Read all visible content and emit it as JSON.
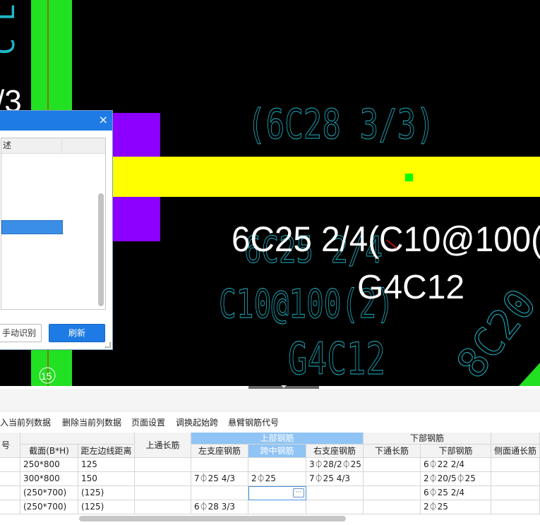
{
  "cad": {
    "frag_top_left": "C L",
    "frag_fraction": "/3",
    "annot_cyan_top": "(6C28 3/3)",
    "annot_white_main": "6C25 2/4(C10@100(",
    "annot_cyan_mid": "6C25 2/4",
    "annot_cyan_stirrup": "C10@100(2)",
    "annot_white_g": "G4C12",
    "annot_cyan_g": "G4C12",
    "annot_cyan_diag": "8C20",
    "axis_label": "15",
    "colors": {
      "background": "#000000",
      "column_green": "#22e022",
      "beam_yellow": "#ffff00",
      "support_purple": "#8b00ff",
      "cyan_text": "#1fb7c8",
      "white_text": "#ffffff",
      "axis_red": "#e01010"
    }
  },
  "dialog": {
    "close_icon": "×",
    "list_header": "述",
    "btn_manual": "手动识别",
    "btn_refresh": "刷新"
  },
  "toolbar": {
    "items": [
      "入当前列数据",
      "删除当前列数据",
      "页面设置",
      "调换起始跨",
      "悬臂钢筋代号"
    ]
  },
  "table": {
    "group_headers": {
      "top_rebar": "上部钢筋",
      "bottom_rebar": "下部钢筋"
    },
    "headers": {
      "id": "号",
      "section": "截面(B*H)",
      "dist_left": "距左边线距离",
      "top_through": "上通长筋",
      "left_support": "左支座钢筋",
      "mid_span": "跨中钢筋",
      "right_support": "右支座钢筋",
      "bottom_through": "下通长筋",
      "bottom_rebar": "下部钢筋",
      "side_through": "侧面通长筋"
    },
    "rows": [
      {
        "section": "250*800",
        "dist": "125",
        "top_through": "",
        "left_support": "",
        "mid_span": "",
        "right_support": "3⏀28/2⏀25",
        "bottom_through": "",
        "bottom_rebar": "6⏀22 2/4"
      },
      {
        "section": "300*800",
        "dist": "150",
        "top_through": "",
        "left_support": "7⏀25 4/3",
        "mid_span": "2⏀25",
        "right_support": "7⏀25 4/3",
        "bottom_through": "",
        "bottom_rebar": "2⏀20/5⏀25"
      },
      {
        "section": "(250*700)",
        "dist": "(125)",
        "top_through": "",
        "left_support": "",
        "mid_span": "",
        "right_support": "",
        "bottom_through": "",
        "bottom_rebar": "6⏀25 2/4"
      },
      {
        "section": "(250*700)",
        "dist": "(125)",
        "top_through": "",
        "left_support": "6⏀28 3/3",
        "mid_span": "",
        "right_support": "",
        "bottom_through": "",
        "bottom_rebar": "2⏀25"
      }
    ],
    "edit_button": "···"
  }
}
